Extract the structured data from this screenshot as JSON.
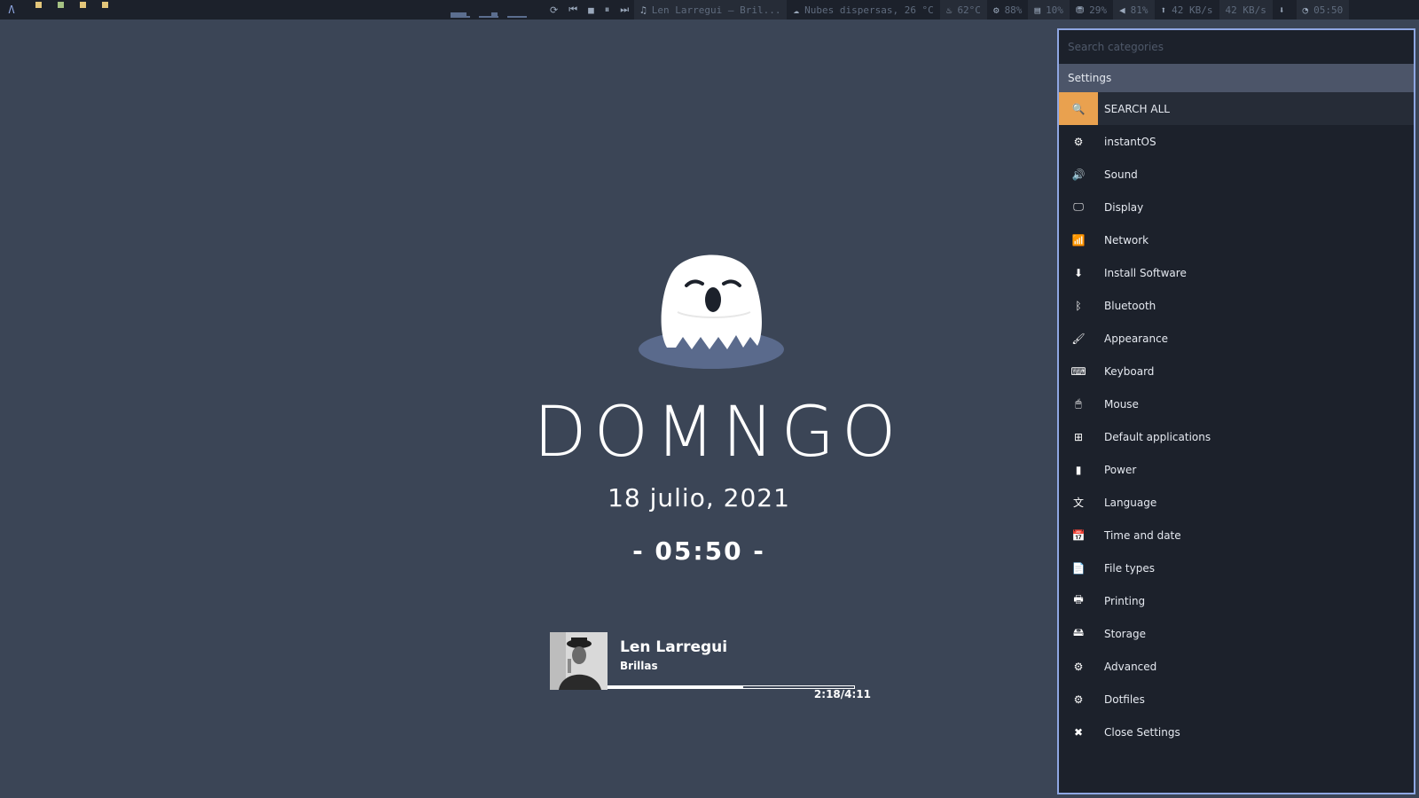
{
  "topbar": {
    "logo": "Λ",
    "tag_colors": [
      "#e3c67a",
      "#a6c283",
      "#e3c67a",
      "#e3c67a"
    ],
    "controls": [
      "⟳",
      "⏮",
      "■",
      "⏸",
      "⏭"
    ],
    "segments": [
      {
        "icon": "music-icon",
        "glyph": "♫",
        "text": "Len Larregui – Bril..."
      },
      {
        "icon": "weather-icon",
        "glyph": "☁",
        "text": "Nubes dispersas, 26 °C"
      },
      {
        "icon": "temperature-icon",
        "glyph": "♨",
        "text": "62°C"
      },
      {
        "icon": "cpu-icon",
        "glyph": "⚙",
        "text": "88%"
      },
      {
        "icon": "memory-icon",
        "glyph": "▤",
        "text": "10%"
      },
      {
        "icon": "disk-icon",
        "glyph": "⛃",
        "text": "29%"
      },
      {
        "icon": "volume-icon",
        "glyph": "◀",
        "text": "81%"
      },
      {
        "icon": "upload-icon",
        "glyph": "⬆",
        "text": "42 KB/s"
      },
      {
        "icon": "download-speed",
        "glyph": "",
        "text": "42 KB/s"
      },
      {
        "icon": "clock-icon",
        "glyph": "⬇",
        "text": ""
      },
      {
        "icon": "time-icon",
        "glyph": "◔",
        "text": "05:50"
      }
    ]
  },
  "lockscreen": {
    "day": "DOMNGO",
    "date": "18 julio, 2021",
    "time": "- 05:50 -",
    "player": {
      "artist": "Len Larregui",
      "track": "Brillas",
      "position": "2:18/4:11",
      "progress": 0.55
    }
  },
  "settings": {
    "search_placeholder": "Search categories",
    "header": "Settings",
    "items": [
      {
        "label": "SEARCH ALL",
        "icon": "search-icon",
        "glyph": "🔍"
      },
      {
        "label": "instantOS",
        "icon": "gear-icon",
        "glyph": "⚙"
      },
      {
        "label": "Sound",
        "icon": "speaker-icon",
        "glyph": "🔊"
      },
      {
        "label": "Display",
        "icon": "monitor-icon",
        "glyph": "🖵"
      },
      {
        "label": "Network",
        "icon": "wifi-icon",
        "glyph": "📶"
      },
      {
        "label": "Install Software",
        "icon": "download-icon",
        "glyph": "⬇"
      },
      {
        "label": "Bluetooth",
        "icon": "bluetooth-icon",
        "glyph": "ᛒ"
      },
      {
        "label": "Appearance",
        "icon": "brush-icon",
        "glyph": "🖌"
      },
      {
        "label": "Keyboard",
        "icon": "keyboard-icon",
        "glyph": "⌨"
      },
      {
        "label": "Mouse",
        "icon": "mouse-icon",
        "glyph": "🖱"
      },
      {
        "label": "Default applications",
        "icon": "grid-icon",
        "glyph": "⊞"
      },
      {
        "label": "Power",
        "icon": "battery-icon",
        "glyph": "▮"
      },
      {
        "label": "Language",
        "icon": "language-icon",
        "glyph": "文"
      },
      {
        "label": "Time and date",
        "icon": "calendar-icon",
        "glyph": "📅"
      },
      {
        "label": "File types",
        "icon": "file-icon",
        "glyph": "📄"
      },
      {
        "label": "Printing",
        "icon": "printer-icon",
        "glyph": "🖶"
      },
      {
        "label": "Storage",
        "icon": "hdd-icon",
        "glyph": "🖴"
      },
      {
        "label": "Advanced",
        "icon": "cogs-icon",
        "glyph": "⚙"
      },
      {
        "label": "Dotfiles",
        "icon": "gear-icon",
        "glyph": "⚙"
      },
      {
        "label": "Close Settings",
        "icon": "close-icon",
        "glyph": "✖"
      }
    ]
  },
  "colors": {
    "desktop": "#3b4556",
    "panel": "#1c212b",
    "accent": "#e9a14f",
    "border": "#8fa7e3"
  }
}
